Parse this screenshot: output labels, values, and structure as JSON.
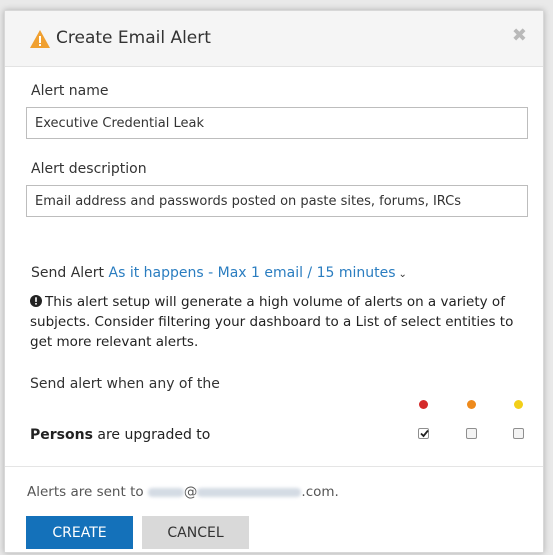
{
  "dialog": {
    "title": "Create Email Alert",
    "close_icon": "close-icon",
    "warning_icon": "warning-triangle-icon"
  },
  "alert_name": {
    "label": "Alert name",
    "value": "Executive Credential Leak"
  },
  "alert_description": {
    "label": "Alert description",
    "value": "Email address and passwords posted on paste sites, forums, IRCs"
  },
  "send_alert": {
    "label": "Send Alert",
    "frequency": "As it happens - Max 1 email / 15 minutes",
    "chevron_icon": "chevron-down-icon"
  },
  "notice": {
    "icon": "info-icon",
    "text": "This alert setup will generate a high volume of alerts on a variety of subjects. Consider filtering your dashboard to a List of select entities to get more relevant alerts."
  },
  "conditions": {
    "intro": "Send alert when any of the",
    "severity_colors": [
      "#d42a2a",
      "#ee8a1c",
      "#f2cf19"
    ],
    "row_entity": "Persons",
    "row_suffix": "are upgraded to",
    "checkboxes": [
      true,
      false,
      false
    ]
  },
  "footer": {
    "sent_to_prefix": "Alerts are sent to",
    "email_at": "@",
    "email_suffix": ".com."
  },
  "buttons": {
    "create": "CREATE",
    "cancel": "CANCEL"
  },
  "colors": {
    "primary": "#1471ba",
    "link": "#2a7dc0",
    "warning": "#f0a030"
  }
}
